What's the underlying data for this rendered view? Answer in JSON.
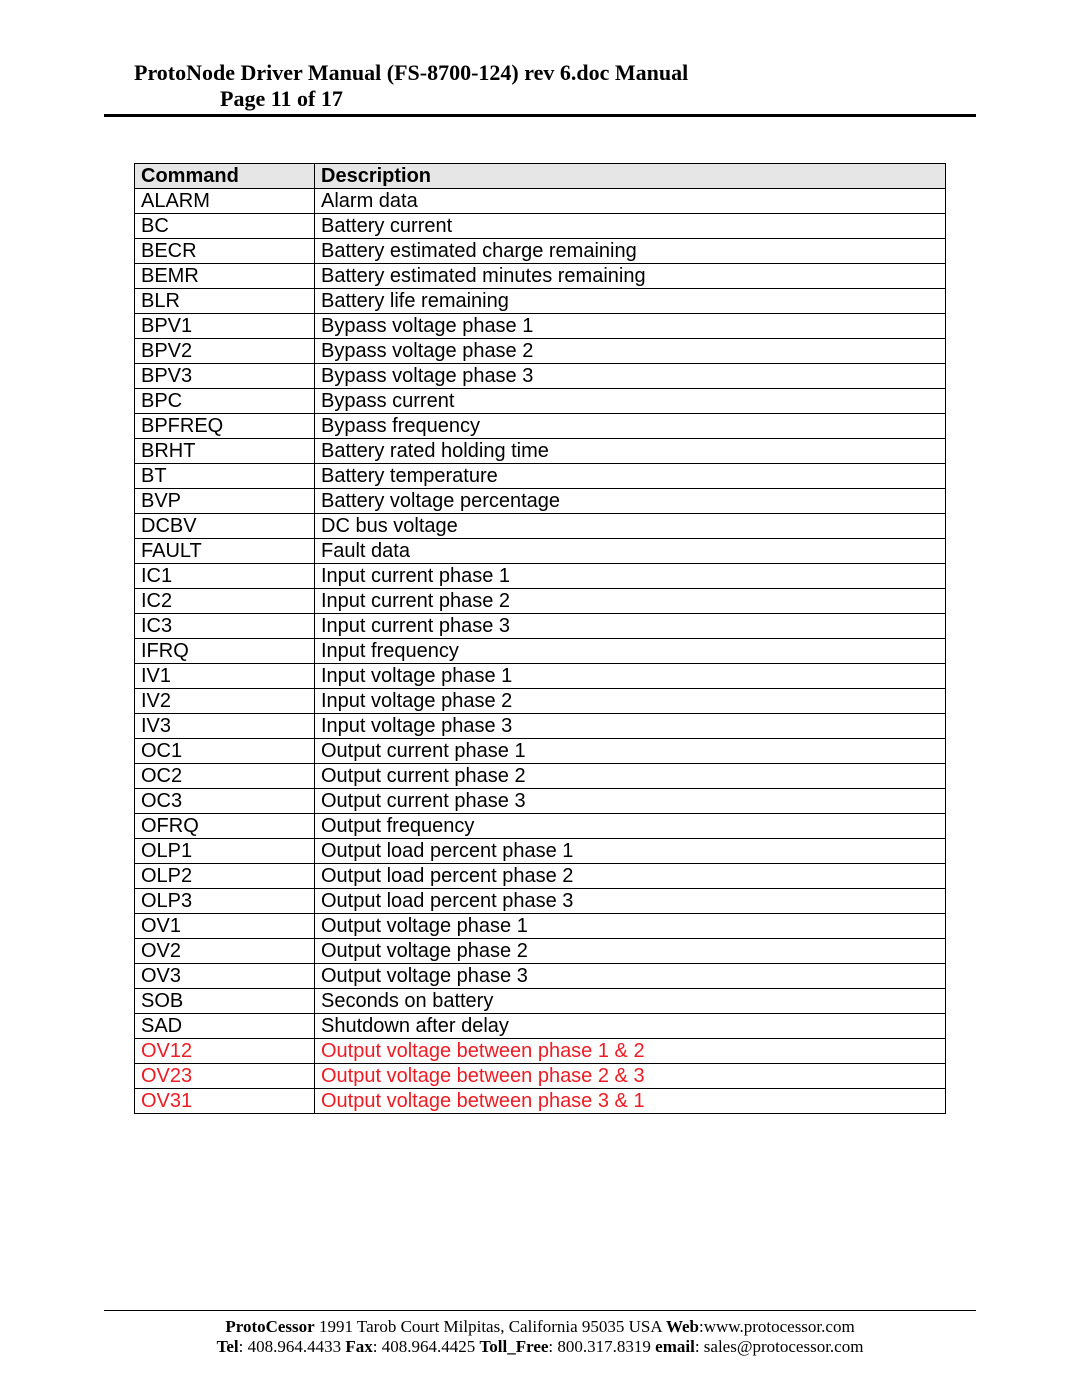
{
  "header": {
    "title": "ProtoNode Driver Manual (FS-8700-124) rev 6.doc Manual",
    "page_label": "Page 11 of 17"
  },
  "table": {
    "headers": {
      "command": "Command",
      "description": "Description"
    },
    "rows": [
      {
        "cmd": "ALARM",
        "desc": "Alarm data",
        "highlight": false
      },
      {
        "cmd": "BC",
        "desc": "Battery current",
        "highlight": false
      },
      {
        "cmd": "BECR",
        "desc": "Battery estimated charge remaining",
        "highlight": false
      },
      {
        "cmd": "BEMR",
        "desc": "Battery estimated minutes remaining",
        "highlight": false
      },
      {
        "cmd": "BLR",
        "desc": "Battery life remaining",
        "highlight": false
      },
      {
        "cmd": "BPV1",
        "desc": "Bypass voltage phase 1",
        "highlight": false
      },
      {
        "cmd": "BPV2",
        "desc": "Bypass voltage phase 2",
        "highlight": false
      },
      {
        "cmd": "BPV3",
        "desc": "Bypass voltage phase 3",
        "highlight": false
      },
      {
        "cmd": "BPC",
        "desc": "Bypass current",
        "highlight": false
      },
      {
        "cmd": "BPFREQ",
        "desc": "Bypass frequency",
        "highlight": false
      },
      {
        "cmd": "BRHT",
        "desc": "Battery rated holding time",
        "highlight": false
      },
      {
        "cmd": "BT",
        "desc": "Battery temperature",
        "highlight": false
      },
      {
        "cmd": "BVP",
        "desc": "Battery voltage percentage",
        "highlight": false
      },
      {
        "cmd": "DCBV",
        "desc": "DC bus voltage",
        "highlight": false
      },
      {
        "cmd": "FAULT",
        "desc": "Fault data",
        "highlight": false
      },
      {
        "cmd": "IC1",
        "desc": "Input current phase 1",
        "highlight": false
      },
      {
        "cmd": "IC2",
        "desc": "Input current phase 2",
        "highlight": false
      },
      {
        "cmd": "IC3",
        "desc": "Input current phase 3",
        "highlight": false
      },
      {
        "cmd": "IFRQ",
        "desc": "Input frequency",
        "highlight": false
      },
      {
        "cmd": "IV1",
        "desc": "Input voltage phase 1",
        "highlight": false
      },
      {
        "cmd": "IV2",
        "desc": "Input voltage phase 2",
        "highlight": false
      },
      {
        "cmd": "IV3",
        "desc": "Input voltage phase 3",
        "highlight": false
      },
      {
        "cmd": "OC1",
        "desc": "Output current phase 1",
        "highlight": false
      },
      {
        "cmd": "OC2",
        "desc": "Output current phase 2",
        "highlight": false
      },
      {
        "cmd": "OC3",
        "desc": "Output current phase 3",
        "highlight": false
      },
      {
        "cmd": "OFRQ",
        "desc": "Output frequency",
        "highlight": false
      },
      {
        "cmd": "OLP1",
        "desc": "Output load percent phase 1",
        "highlight": false
      },
      {
        "cmd": "OLP2",
        "desc": "Output load percent phase 2",
        "highlight": false
      },
      {
        "cmd": "OLP3",
        "desc": "Output load percent phase 3",
        "highlight": false
      },
      {
        "cmd": "OV1",
        "desc": "Output voltage phase 1",
        "highlight": false
      },
      {
        "cmd": "OV2",
        "desc": "Output voltage phase 2",
        "highlight": false
      },
      {
        "cmd": "OV3",
        "desc": "Output voltage phase 3",
        "highlight": false
      },
      {
        "cmd": "SOB",
        "desc": "Seconds on battery",
        "highlight": false
      },
      {
        "cmd": "SAD",
        "desc": "Shutdown after delay",
        "highlight": false
      },
      {
        "cmd": "OV12",
        "desc": "Output voltage between phase 1 & 2",
        "highlight": true
      },
      {
        "cmd": "OV23",
        "desc": "Output voltage between phase 2 & 3",
        "highlight": true
      },
      {
        "cmd": "OV31",
        "desc": "Output voltage between phase 3 & 1",
        "highlight": true
      }
    ]
  },
  "footer": {
    "company": "ProtoCessor",
    "address": " 1991 Tarob Court Milpitas, California 95035 USA  ",
    "web_label": "Web",
    "web_value": ":www.protocessor.com",
    "tel_label": "Tel",
    "tel_value": ": 408.964.4433  ",
    "fax_label": "Fax",
    "fax_value": ": 408.964.4425  ",
    "tollfree_label": "Toll_Free",
    "tollfree_value": ": 800.317.8319  ",
    "email_label": "email",
    "email_value": ": sales@protocessor.com"
  }
}
